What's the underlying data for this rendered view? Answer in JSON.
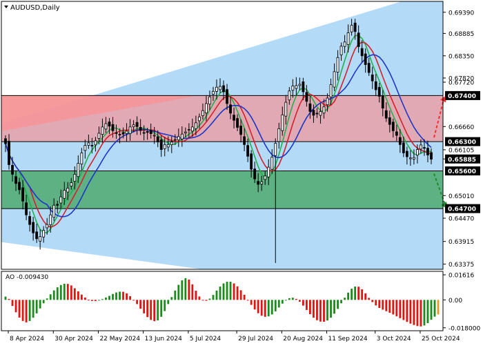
{
  "chart_data": [
    {
      "type": "candlestick",
      "title": "AUDUSD,Daily",
      "symbol": "AUDUSD",
      "timeframe": "Daily",
      "ylim": [
        0.6325,
        0.6965
      ],
      "y_tick_labels": [
        "0.69390",
        "0.68885",
        "0.68350",
        "0.67820",
        "0.67720",
        "0.66660",
        "0.66105",
        "0.65885",
        "0.65010",
        "0.64470",
        "0.63915",
        "0.63375"
      ],
      "price_tags": [
        {
          "label": "0.67400",
          "value": 0.674
        },
        {
          "label": "0.66300",
          "value": 0.663
        },
        {
          "label": "0.65885",
          "value": 0.65885
        },
        {
          "label": "0.65600",
          "value": 0.656
        },
        {
          "label": "0.64700",
          "value": 0.647
        }
      ],
      "x_tick_labels": [
        "8 Apr 2024",
        "30 Apr 2024",
        "22 May 2024",
        "13 Jun 2024",
        "5 Jul 2024",
        "29 Jul 2024",
        "20 Aug 2024",
        "11 Sep 2024",
        "3 Oct 2024",
        "25 Oct 2024"
      ],
      "zones": [
        {
          "name": "resistance",
          "from": 0.663,
          "to": 0.674,
          "color": "#e8a0a8"
        },
        {
          "name": "support",
          "from": 0.647,
          "to": 0.656,
          "color": "#5aaf7c"
        }
      ],
      "channel_color": "#b3daf7",
      "scenario_arrows": [
        {
          "direction": "up",
          "from": 0.663,
          "to": 0.674,
          "color": "#ff2a2a"
        },
        {
          "direction": "down",
          "from": 0.656,
          "to": 0.647,
          "color": "#1f8a2a"
        }
      ],
      "moving_averages": [
        {
          "color": "#22b04a"
        },
        {
          "color": "#d4202a"
        },
        {
          "color": "#1b36c9"
        }
      ],
      "close": [
        0.6625,
        0.6575,
        0.6552,
        0.653,
        0.6515,
        0.6488,
        0.6455,
        0.6432,
        0.6412,
        0.6398,
        0.6403,
        0.6418,
        0.6432,
        0.6455,
        0.6478,
        0.6478,
        0.6498,
        0.6514,
        0.6519,
        0.6532,
        0.6552,
        0.6578,
        0.6603,
        0.6621,
        0.6627,
        0.6621,
        0.6632,
        0.665,
        0.6665,
        0.6673,
        0.6667,
        0.6656,
        0.665,
        0.6646,
        0.6648,
        0.6655,
        0.6665,
        0.667,
        0.6666,
        0.6657,
        0.6651,
        0.6652,
        0.6649,
        0.6645,
        0.6629,
        0.6611,
        0.6623,
        0.6623,
        0.6629,
        0.6635,
        0.6642,
        0.6648,
        0.6653,
        0.6659,
        0.6665,
        0.6675,
        0.6689,
        0.6704,
        0.6721,
        0.6737,
        0.675,
        0.676,
        0.6762,
        0.6749,
        0.6721,
        0.6698,
        0.6681,
        0.6664,
        0.6647,
        0.6623,
        0.6595,
        0.6564,
        0.6541,
        0.6528,
        0.6534,
        0.6548,
        0.6569,
        0.6593,
        0.6626,
        0.6661,
        0.6694,
        0.6724,
        0.6751,
        0.6763,
        0.6764,
        0.6767,
        0.6749,
        0.6726,
        0.6702,
        0.6693,
        0.6697,
        0.6702,
        0.6713,
        0.6734,
        0.6766,
        0.6797,
        0.6831,
        0.6858,
        0.6868,
        0.689,
        0.6908,
        0.6893,
        0.6857,
        0.6835,
        0.6814,
        0.6795,
        0.6775,
        0.6754,
        0.6738,
        0.671,
        0.6686,
        0.6671,
        0.6656,
        0.6645,
        0.6623,
        0.6603,
        0.6594,
        0.6591,
        0.6592,
        0.6611,
        0.6622,
        0.6614,
        0.6598,
        0.6588
      ],
      "ao": {
        "label": "AO -0.009430",
        "current": -0.00943,
        "ylim": [
          -0.019,
          0.0175
        ],
        "y_tick_labels": [
          "0.01616",
          "0.00",
          "-0.018000"
        ],
        "up_color": "#1a8a1a",
        "down_color": "#e0140e",
        "values": [
          0.0021,
          0.0006,
          -0.0039,
          -0.008,
          -0.0114,
          -0.0136,
          -0.0145,
          -0.0136,
          -0.0115,
          -0.0087,
          -0.0055,
          -0.0022,
          0.0009,
          0.0036,
          0.0061,
          0.0081,
          0.0096,
          0.0104,
          0.0103,
          0.0093,
          0.0075,
          0.0055,
          0.0034,
          0.0015,
          0.0001,
          -0.0007,
          -0.0008,
          -0.0003,
          0.0005,
          0.0015,
          0.0026,
          0.0038,
          0.0048,
          0.0053,
          0.0052,
          0.0042,
          0.0024,
          0.0,
          -0.0027,
          -0.0057,
          -0.0087,
          -0.0111,
          -0.0129,
          -0.0137,
          -0.0132,
          -0.0109,
          -0.0072,
          -0.0027,
          0.0018,
          0.006,
          0.0097,
          0.0126,
          0.014,
          0.0131,
          0.01,
          0.0059,
          0.0022,
          -0.0002,
          -0.0006,
          0.0008,
          0.0032,
          0.006,
          0.0086,
          0.0106,
          0.0117,
          0.0117,
          0.0106,
          0.0087,
          0.0062,
          0.0033,
          0.0,
          -0.0032,
          -0.0062,
          -0.0086,
          -0.0102,
          -0.0109,
          -0.0106,
          -0.0094,
          -0.0074,
          -0.0049,
          -0.0024,
          -0.0003,
          0.0011,
          0.0014,
          0.0006,
          -0.0012,
          -0.0037,
          -0.0065,
          -0.0092,
          -0.0115,
          -0.0131,
          -0.014,
          -0.0141,
          -0.0133,
          -0.0115,
          -0.0089,
          -0.0058,
          -0.0022,
          0.0014,
          0.0047,
          0.0072,
          0.0086,
          0.0085,
          0.0068,
          0.0042,
          0.0013,
          -0.0014,
          -0.0036,
          -0.0052,
          -0.0063,
          -0.0073,
          -0.0083,
          -0.0094,
          -0.0106,
          -0.0118,
          -0.013,
          -0.0142,
          -0.0153,
          -0.0162,
          -0.0169,
          -0.0171,
          -0.0165,
          -0.015,
          -0.0128,
          -0.0108,
          -0.0094
        ]
      }
    }
  ]
}
